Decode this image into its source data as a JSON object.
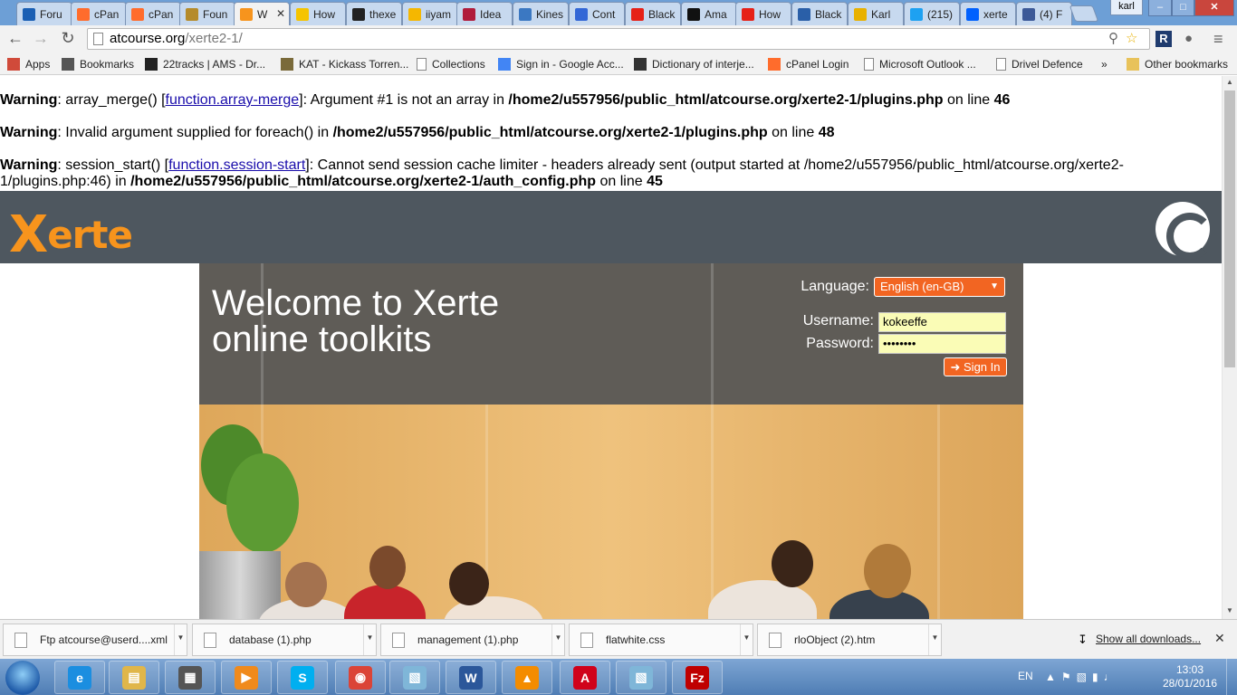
{
  "browser": {
    "tabs": [
      {
        "label": "Foru",
        "icon": "forum-icon",
        "color": "#1a5fb4"
      },
      {
        "label": "cPan",
        "icon": "cpanel-icon",
        "color": "#ff6c2c"
      },
      {
        "label": "cPan",
        "icon": "cpanel-icon",
        "color": "#ff6c2c"
      },
      {
        "label": "Foun",
        "icon": "foundation-icon",
        "color": "#b58b2b"
      },
      {
        "label": "W",
        "icon": "xerte-icon",
        "color": "#f7941d",
        "active": true
      },
      {
        "label": "How",
        "icon": "note-icon",
        "color": "#f5c400"
      },
      {
        "label": "thexe",
        "icon": "github-icon",
        "color": "#222222"
      },
      {
        "label": "iiyam",
        "icon": "face-icon",
        "color": "#f5b700"
      },
      {
        "label": "Idea",
        "icon": "idea-icon",
        "color": "#b01c3c"
      },
      {
        "label": "Kines",
        "icon": "kinesis-icon",
        "color": "#3b78c2"
      },
      {
        "label": "Cont",
        "icon": "cont-icon",
        "color": "#3367d6"
      },
      {
        "label": "Black",
        "icon": "youtube-icon",
        "color": "#e62117"
      },
      {
        "label": "Ama",
        "icon": "amazon-icon",
        "color": "#111111"
      },
      {
        "label": "How",
        "icon": "youtube-icon",
        "color": "#e62117"
      },
      {
        "label": "Black",
        "icon": "black-icon",
        "color": "#2a5fa8"
      },
      {
        "label": "Karl",
        "icon": "karl-icon",
        "color": "#e8b100"
      },
      {
        "label": "(215)",
        "icon": "twitter-icon",
        "color": "#1da1f2"
      },
      {
        "label": "xerte",
        "icon": "dropbox-icon",
        "color": "#0061fe"
      },
      {
        "label": "(4) F",
        "icon": "facebook-icon",
        "color": "#3b5998"
      }
    ],
    "profile": "karl",
    "window_buttons": {
      "min": "–",
      "max": "□",
      "close": "✕"
    },
    "url_host": "atcourse.org",
    "url_path": "/xerte2-1/",
    "bookmarks": [
      {
        "label": "Apps",
        "icon": "apps-icon"
      },
      {
        "label": "Bookmarks",
        "icon": "star-icon"
      },
      {
        "label": "22tracks | AMS - Dr...",
        "icon": "tracks-icon"
      },
      {
        "label": "KAT - Kickass Torren...",
        "icon": "kat-icon"
      },
      {
        "label": "Collections",
        "icon": "page-icon"
      },
      {
        "label": "Sign in - Google Acc...",
        "icon": "google-icon"
      },
      {
        "label": "Dictionary of interje...",
        "icon": "dictionary-icon"
      },
      {
        "label": "cPanel Login",
        "icon": "cpanel-icon"
      },
      {
        "label": "Microsoft Outlook ...",
        "icon": "page-icon"
      },
      {
        "label": "Drivel Defence",
        "icon": "page-icon"
      },
      {
        "label": "»",
        "icon": ""
      },
      {
        "label": "Other bookmarks",
        "icon": "folder-icon"
      }
    ]
  },
  "warnings": [
    {
      "label": "Warning",
      "pre": ": array_merge() [",
      "link": "function.array-merge",
      "post": "]: Argument #1 is not an array in ",
      "file": "/home2/u557956/public_html/atcourse.org/xerte2-1/plugins.php",
      "online": " on line ",
      "line": "46"
    },
    {
      "label": "Warning",
      "pre": ": Invalid argument supplied for foreach() in ",
      "link": "",
      "post": "",
      "file": "/home2/u557956/public_html/atcourse.org/xerte2-1/plugins.php",
      "online": " on line ",
      "line": "48"
    },
    {
      "label": "Warning",
      "pre": ": session_start() [",
      "link": "function.session-start",
      "post": "]: Cannot send session cache limiter - headers already sent (output started at /home2/u557956/public_html/atcourse.org/xerte2-1/plugins.php:46) in ",
      "file": "/home2/u557956/public_html/atcourse.org/xerte2-1/auth_config.php",
      "online": " on line ",
      "line": "45"
    }
  ],
  "xerte": {
    "logo_first": "X",
    "logo_rest": "erte",
    "welcome_line1": "Welcome to Xerte",
    "welcome_line2": "online toolkits",
    "language_label": "Language:",
    "language_value": "English (en-GB)",
    "username_label": "Username:",
    "username_value": "kokeeffe",
    "password_label": "Password:",
    "password_value": "••••••••",
    "signin_label": "➜ Sign In",
    "accent": "#f26522",
    "header_bg": "#4e575f"
  },
  "downloads": {
    "items": [
      {
        "label": "Ftp atcourse@userd....xml"
      },
      {
        "label": "database (1).php"
      },
      {
        "label": "management (1).php"
      },
      {
        "label": "flatwhite.css"
      },
      {
        "label": "rloObject (2).htm"
      }
    ],
    "show_all": "Show all downloads..."
  },
  "taskbar": {
    "apps": [
      {
        "name": "internet-explorer-icon",
        "glyph": "e",
        "color": "#1b8ee0"
      },
      {
        "name": "file-explorer-icon",
        "glyph": "▤",
        "color": "#e0b64a"
      },
      {
        "name": "calculator-icon",
        "glyph": "▦",
        "color": "#555555"
      },
      {
        "name": "media-player-icon",
        "glyph": "▶",
        "color": "#f08a1c"
      },
      {
        "name": "skype-icon",
        "glyph": "S",
        "color": "#00aff0"
      },
      {
        "name": "chrome-icon",
        "glyph": "◉",
        "color": "#db4437"
      },
      {
        "name": "notepad-icon",
        "glyph": "▧",
        "color": "#7fb6d8"
      },
      {
        "name": "word-icon",
        "glyph": "W",
        "color": "#2b579a"
      },
      {
        "name": "vlc-icon",
        "glyph": "▲",
        "color": "#f48c00"
      },
      {
        "name": "acrobat-icon",
        "glyph": "A",
        "color": "#d0021b"
      },
      {
        "name": "notepad-icon",
        "glyph": "▧",
        "color": "#7fb6d8"
      },
      {
        "name": "filezilla-icon",
        "glyph": "Fz",
        "color": "#bf0000"
      }
    ],
    "lang": "EN",
    "time": "13:03",
    "date": "28/01/2016"
  }
}
